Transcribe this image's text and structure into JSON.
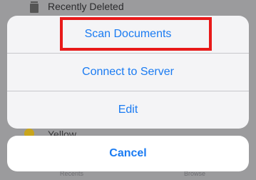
{
  "background": {
    "top_row_label": "Recently Deleted",
    "yellow_row_label": "Yellow",
    "tab_recents": "Recents",
    "tab_browse": "Browse"
  },
  "action_sheet": {
    "items": [
      {
        "label": "Scan Documents"
      },
      {
        "label": "Connect to Server"
      },
      {
        "label": "Edit"
      }
    ],
    "cancel_label": "Cancel"
  },
  "colors": {
    "accent": "#1a7bf2",
    "highlight": "#e81a1a",
    "tag_yellow": "#c9a51c"
  },
  "icons": {
    "top_row": "trash-icon",
    "yellow_row": "yellow-tag-dot"
  }
}
